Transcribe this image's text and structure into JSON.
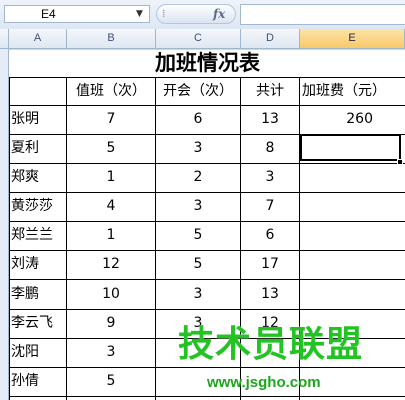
{
  "formula_bar": {
    "name_box": "E4",
    "fx_label": "fx",
    "formula": ""
  },
  "columns": [
    "A",
    "B",
    "C",
    "D",
    "E"
  ],
  "sheet": {
    "title": "加班情况表",
    "headers": {
      "duty": "值班（次）",
      "meeting": "开会（次）",
      "total": "共计",
      "fee": "加班费（元）"
    },
    "rows": [
      {
        "name": "张明",
        "duty": "7",
        "meeting": "6",
        "total": "13",
        "fee": "260"
      },
      {
        "name": "夏利",
        "duty": "5",
        "meeting": "3",
        "total": "8",
        "fee": ""
      },
      {
        "name": "郑爽",
        "duty": "1",
        "meeting": "2",
        "total": "3",
        "fee": ""
      },
      {
        "name": "黄莎莎",
        "duty": "4",
        "meeting": "3",
        "total": "7",
        "fee": ""
      },
      {
        "name": "郑兰兰",
        "duty": "1",
        "meeting": "5",
        "total": "6",
        "fee": ""
      },
      {
        "name": "刘涛",
        "duty": "12",
        "meeting": "5",
        "total": "17",
        "fee": ""
      },
      {
        "name": "李鹏",
        "duty": "10",
        "meeting": "3",
        "total": "13",
        "fee": ""
      },
      {
        "name": "李云飞",
        "duty": "9",
        "meeting": "3",
        "total": "12",
        "fee": ""
      },
      {
        "name": "沈阳",
        "duty": "3",
        "meeting": "",
        "total": "",
        "fee": ""
      },
      {
        "name": "孙倩",
        "duty": "5",
        "meeting": "",
        "total": "",
        "fee": ""
      }
    ]
  },
  "watermark": {
    "text": "技术员联盟",
    "url": "www.jsgho.com"
  },
  "colors": {
    "selected_header": "#f9c96a",
    "watermark": "#22c322",
    "grid": "#d0d7e5"
  }
}
